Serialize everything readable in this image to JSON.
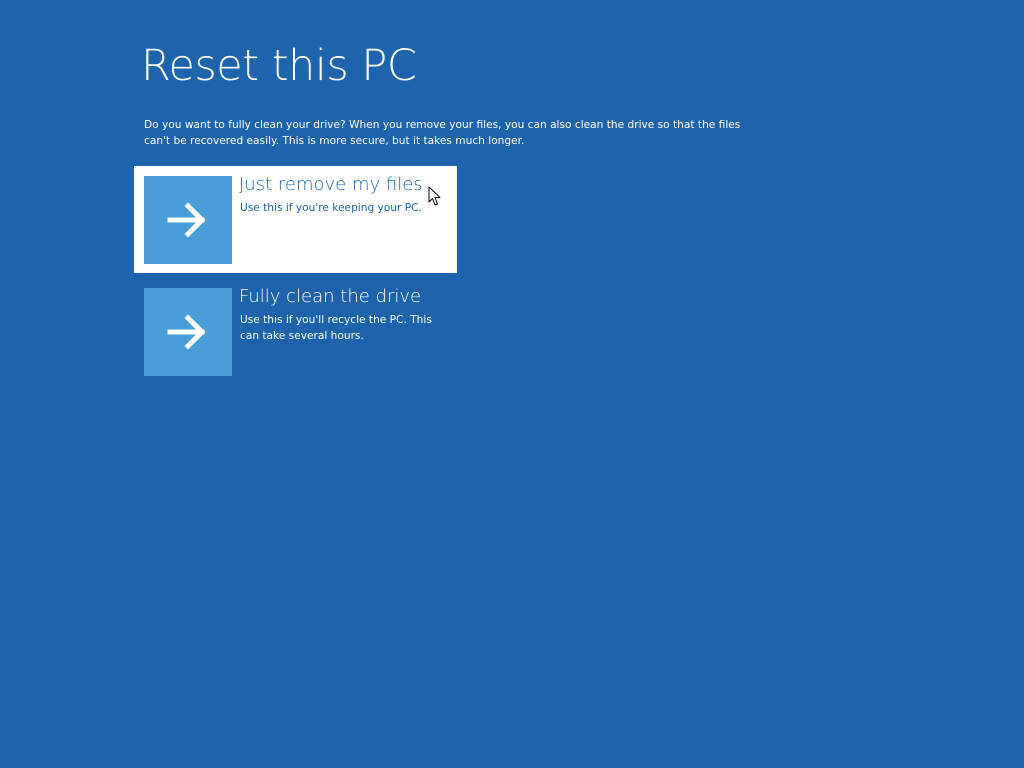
{
  "page": {
    "title": "Reset this PC",
    "description": "Do you want to fully clean your drive? When you remove your files, you can also clean the drive so that the files can't be recovered easily. This is more secure, but it takes much longer."
  },
  "options": [
    {
      "title": "Just remove my files",
      "description": "Use this if you're keeping your PC.",
      "icon": "arrow-right-icon",
      "selected": true
    },
    {
      "title": "Fully clean the drive",
      "description": "Use this if you'll recycle the PC. This can take several hours.",
      "icon": "arrow-right-icon",
      "selected": false
    }
  ],
  "colors": {
    "background": "#1d64ac",
    "tile": "#4a9ed8",
    "selected_background": "#ffffff",
    "selected_text": "#1d64ac",
    "text": "#ffffff"
  }
}
